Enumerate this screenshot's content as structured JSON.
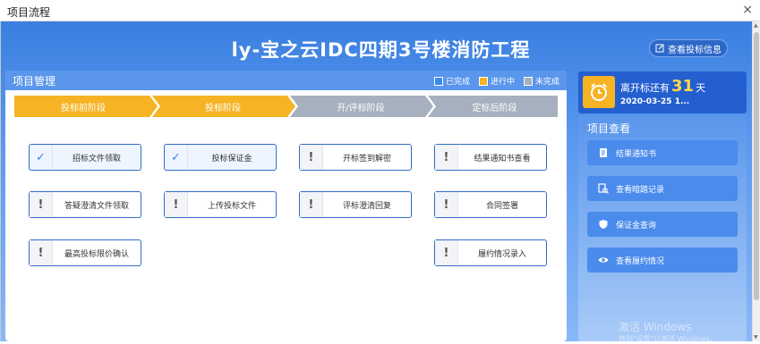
{
  "window": {
    "title": "项目流程",
    "close_glyph": "×"
  },
  "header": {
    "project_title": "ly-宝之云IDC四期3号楼消防工程",
    "bid_info_button": "查看投标信息"
  },
  "panel": {
    "title": "项目管理",
    "legend": [
      {
        "label": "已完成",
        "color": "#3b8bec"
      },
      {
        "label": "进行中",
        "color": "#f6b324"
      },
      {
        "label": "未完成",
        "color": "#a6b0be"
      }
    ]
  },
  "stages": [
    {
      "label": "投标前阶段",
      "status": "in_progress"
    },
    {
      "label": "投标阶段",
      "status": "in_progress"
    },
    {
      "label": "开/评标阶段",
      "status": "pending"
    },
    {
      "label": "定标后阶段",
      "status": "pending"
    }
  ],
  "tasks": {
    "col1": [
      {
        "label": "招标文件领取",
        "state": "done"
      },
      {
        "label": "答疑澄清文件领取",
        "state": "todo"
      },
      {
        "label": "最高投标限价确认",
        "state": "todo"
      }
    ],
    "col2": [
      {
        "label": "投标保证金",
        "state": "done"
      },
      {
        "label": "上传投标文件",
        "state": "todo"
      }
    ],
    "col3": [
      {
        "label": "开标签到解密",
        "state": "todo"
      },
      {
        "label": "评标澄清回复",
        "state": "todo"
      }
    ],
    "col4": [
      {
        "label": "结果通知书查看",
        "state": "todo"
      },
      {
        "label": "合同签署",
        "state": "todo"
      },
      {
        "label": "履约情况录入",
        "state": "todo"
      }
    ]
  },
  "icons": {
    "check": "✓",
    "exclaim": "!"
  },
  "countdown": {
    "prefix": "离开标还有",
    "days": "31",
    "suffix": "天",
    "date": "2020-03-25 1..."
  },
  "side": {
    "title": "项目查看",
    "buttons": [
      {
        "label": "结果通知书",
        "icon": "document-icon"
      },
      {
        "label": "查看暗踏记录",
        "icon": "search-doc-icon"
      },
      {
        "label": "保证金查询",
        "icon": "shield-icon"
      },
      {
        "label": "查看履约情况",
        "icon": "eye-icon"
      }
    ]
  },
  "watermark": {
    "line1": "激活 Windows",
    "line2": "转到\"设置\"以激活 Windows。"
  }
}
